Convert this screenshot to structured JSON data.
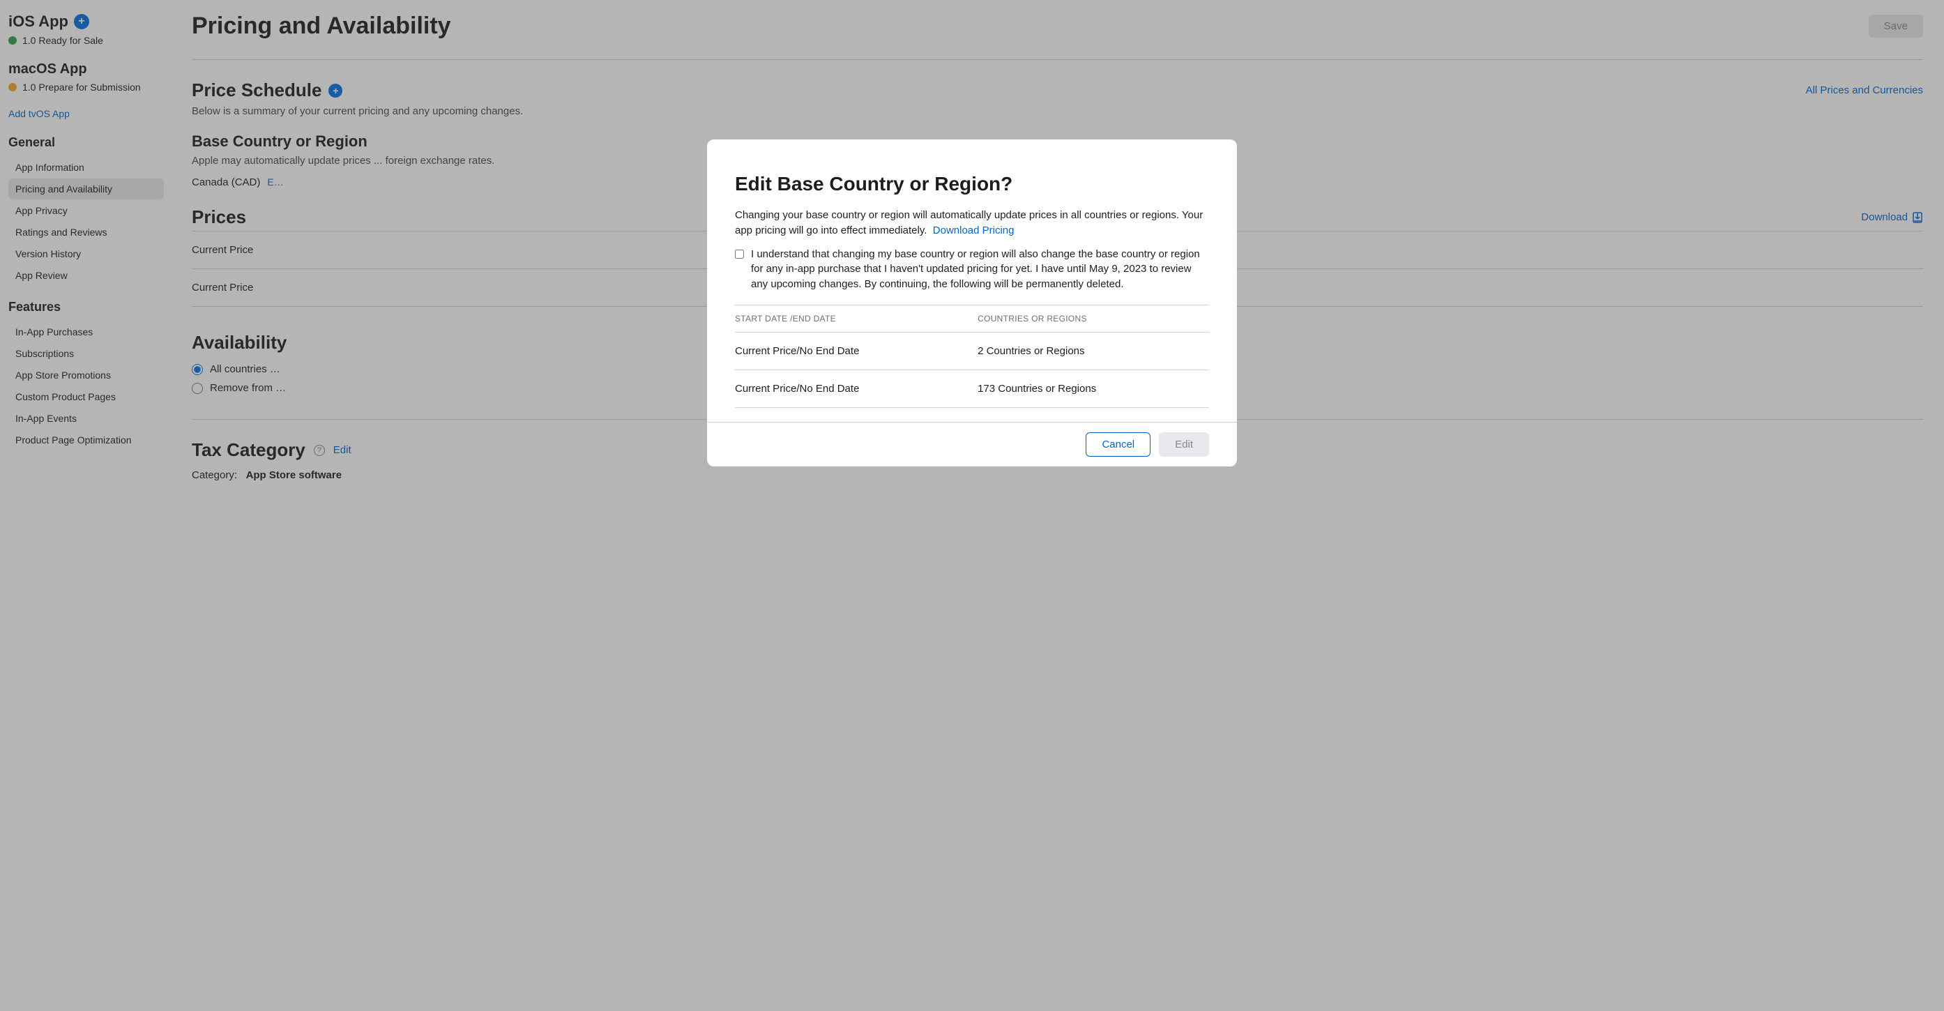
{
  "sidebar": {
    "ios": {
      "title": "iOS App",
      "version_status": "1.0 Ready for Sale"
    },
    "macos": {
      "title": "macOS App",
      "version_status": "1.0 Prepare for Submission"
    },
    "add_tvos": "Add tvOS App",
    "general_title": "General",
    "general_items": [
      "App Information",
      "Pricing and Availability",
      "App Privacy",
      "Ratings and Reviews",
      "Version History",
      "App Review"
    ],
    "features_title": "Features",
    "features_items": [
      "In-App Purchases",
      "Subscriptions",
      "App Store Promotions",
      "Custom Product Pages",
      "In-App Events",
      "Product Page Optimization"
    ]
  },
  "main": {
    "page_title": "Pricing and Availability",
    "save_label": "Save",
    "price_schedule": {
      "title": "Price Schedule",
      "all_prices_link": "All Prices and Currencies",
      "description": "Below is a summary of your current pricing and any upcoming changes."
    },
    "base_region": {
      "title": "Base Country or Region",
      "description": "Apple may automatically update prices ... foreign exchange rates.",
      "value": "Canada (CAD)",
      "edit_label": "E…"
    },
    "prices": {
      "title": "Prices",
      "download_label": "Download",
      "rows": [
        "Current Price",
        "Current Price"
      ]
    },
    "availability": {
      "title": "Availability",
      "option_all": "All countries …",
      "option_remove": "Remove from …"
    },
    "tax": {
      "title": "Tax Category",
      "edit_label": "Edit",
      "category_label": "Category:",
      "category_value": "App Store software"
    }
  },
  "modal": {
    "title": "Edit Base Country or Region?",
    "description": "Changing your base country or region will automatically update prices in all countries or regions. Your app pricing will go into effect immediately.",
    "download_pricing": "Download Pricing",
    "consent": "I understand that changing my base country or region will also change the base country or region for any in-app purchase that I haven't updated pricing for yet. I have until May 9, 2023 to review any upcoming changes. By continuing, the following will be permanently deleted.",
    "table": {
      "col1": "START DATE /END DATE",
      "col2": "COUNTRIES OR REGIONS",
      "rows": [
        {
          "dates": "Current Price/No End Date",
          "regions": "2 Countries or Regions"
        },
        {
          "dates": "Current Price/No End Date",
          "regions": "173 Countries or Regions"
        }
      ]
    },
    "cancel_label": "Cancel",
    "edit_label": "Edit"
  }
}
